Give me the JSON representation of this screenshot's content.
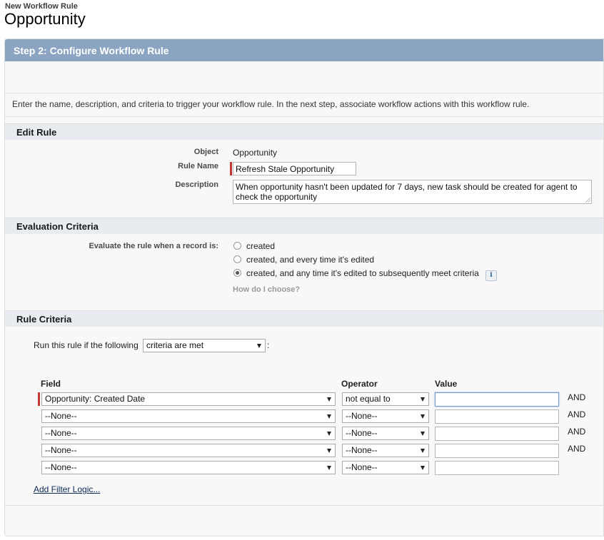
{
  "breadcrumb": "New Workflow Rule",
  "title": "Opportunity",
  "step_title": "Step 2: Configure Workflow Rule",
  "intro": "Enter the name, description, and criteria to trigger your workflow rule. In the next step, associate workflow actions with this workflow rule.",
  "edit_rule": {
    "heading": "Edit Rule",
    "object_label": "Object",
    "object_value": "Opportunity",
    "rule_name_label": "Rule Name",
    "rule_name_value": "Refresh Stale Opportunity",
    "description_label": "Description",
    "description_value": "When opportunity hasn't been updated for 7 days, new task should be created for agent to check the opportunity"
  },
  "evaluation": {
    "heading": "Evaluation Criteria",
    "prompt": "Evaluate the rule when a record is:",
    "options": [
      {
        "label": "created",
        "checked": false
      },
      {
        "label": "created, and every time it's edited",
        "checked": false
      },
      {
        "label": "created, and any time it's edited to subsequently meet criteria",
        "checked": true
      }
    ],
    "info_icon": "info-icon",
    "help_link": "How do I choose?"
  },
  "rule_criteria": {
    "heading": "Rule Criteria",
    "run_prefix": "Run this rule if the following",
    "run_select": "criteria are met",
    "run_suffix": ":",
    "col_field": "Field",
    "col_operator": "Operator",
    "col_value": "Value",
    "rows": [
      {
        "field": "Opportunity: Created Date",
        "operator": "not equal to",
        "value": "",
        "conj": "AND"
      },
      {
        "field": "--None--",
        "operator": "--None--",
        "value": "",
        "conj": "AND"
      },
      {
        "field": "--None--",
        "operator": "--None--",
        "value": "",
        "conj": "AND"
      },
      {
        "field": "--None--",
        "operator": "--None--",
        "value": "",
        "conj": "AND"
      },
      {
        "field": "--None--",
        "operator": "--None--",
        "value": "",
        "conj": ""
      }
    ],
    "filter_link": "Add Filter Logic..."
  },
  "colors": {
    "header": "#8aa4c2",
    "required": "#c23934",
    "section": "#e8ebef"
  }
}
